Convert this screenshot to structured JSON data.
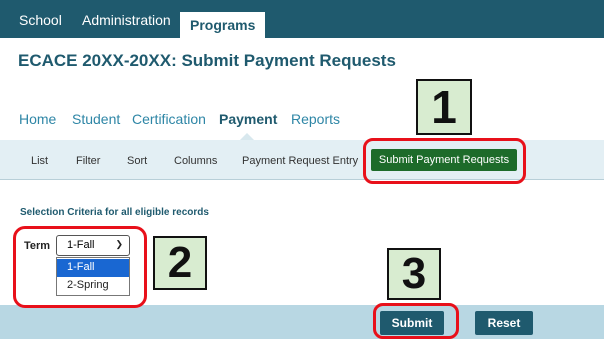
{
  "topbar": {
    "tabs": [
      "School",
      "Administration",
      "Programs"
    ]
  },
  "page_title": "ECACE 20XX-20XX: Submit Payment Requests",
  "nav": {
    "items": [
      "Home",
      "Student",
      "Certification",
      "Payment",
      "Reports"
    ]
  },
  "subnav": {
    "items": [
      "List",
      "Filter",
      "Sort",
      "Columns",
      "Payment Request Entry"
    ],
    "highlight_button": "Submit Payment Requests"
  },
  "criteria_title": "Selection Criteria for all eligible records",
  "term": {
    "label": "Term",
    "selected": "1-Fall",
    "options": [
      "1-Fall",
      "2-Spring"
    ]
  },
  "footer": {
    "submit_label": "Submit",
    "reset_label": "Reset"
  },
  "callouts": {
    "one": "1",
    "two": "2",
    "three": "3"
  },
  "colors": {
    "header": "#1f5a6e",
    "green": "#1d6b2a",
    "red_ring": "#e8101a",
    "callout_bg": "#d8ecd0"
  }
}
